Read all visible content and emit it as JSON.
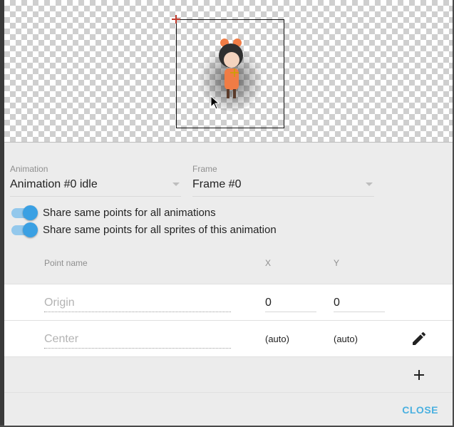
{
  "preview": {
    "background": "checkerboard",
    "origin_marker_color": "#c0392b",
    "icons": [
      "origin-marker-icon",
      "mouse-cursor-icon"
    ]
  },
  "animation_select": {
    "label": "Animation",
    "value": "Animation #0 idle"
  },
  "frame_select": {
    "label": "Frame",
    "value": "Frame #0"
  },
  "toggles": [
    {
      "label": "Share same points for all animations",
      "on": true
    },
    {
      "label": "Share same points for all sprites of this animation",
      "on": true
    }
  ],
  "points_table": {
    "headers": {
      "name": "Point name",
      "x": "X",
      "y": "Y"
    },
    "rows": [
      {
        "name_placeholder": "Origin",
        "x": "0",
        "y": "0"
      },
      {
        "name_placeholder": "Center",
        "x": "(auto)",
        "y": "(auto)",
        "action_icon": "pencil-icon"
      }
    ]
  },
  "add_icon": "plus-icon",
  "close_label": "CLOSE",
  "accent_color": "#3aa0e3"
}
